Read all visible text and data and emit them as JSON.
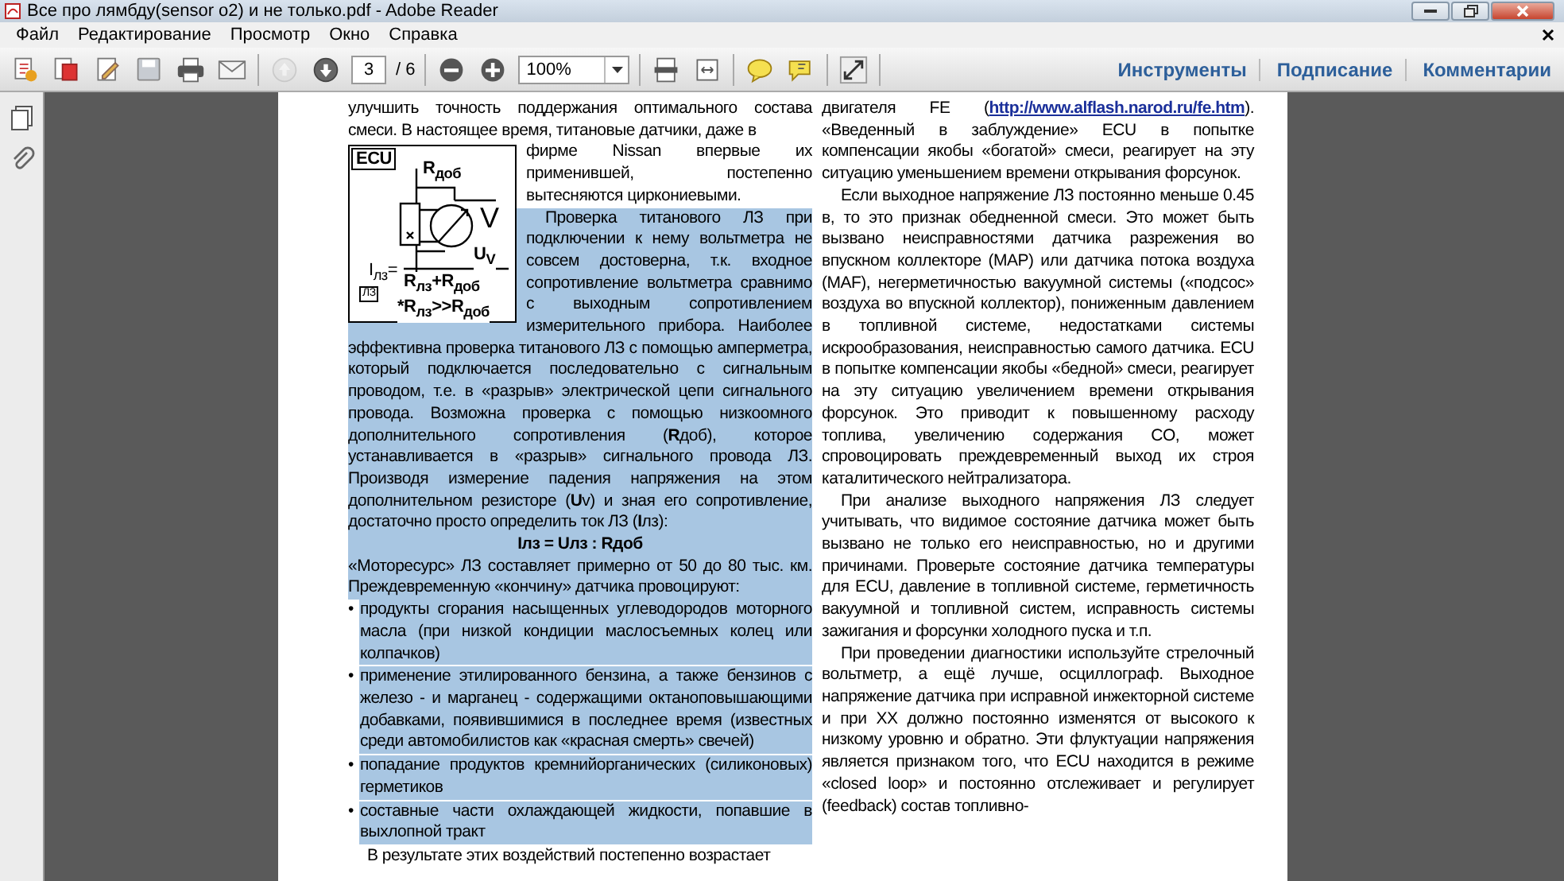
{
  "window": {
    "title": "Все про лямбду(sensor o2) и не только.pdf - Adobe Reader"
  },
  "menu": [
    "Файл",
    "Редактирование",
    "Просмотр",
    "Окно",
    "Справка"
  ],
  "toolbar": {
    "groups": [
      [
        {
          "kind": "create",
          "disabled": false
        },
        {
          "kind": "combine",
          "disabled": false
        },
        {
          "kind": "edit",
          "disabled": false
        },
        {
          "kind": "save",
          "disabled": false
        },
        {
          "kind": "print",
          "disabled": false
        },
        {
          "kind": "mail",
          "disabled": false
        }
      ],
      [
        {
          "kind": "prev",
          "disabled": true
        },
        {
          "kind": "next",
          "disabled": false
        },
        {
          "kind": "page",
          "value": "3",
          "total": "/ 6",
          "disabled": false
        }
      ],
      [
        {
          "kind": "zoom-out",
          "disabled": false
        },
        {
          "kind": "zoom-in",
          "disabled": false
        },
        {
          "kind": "zoom",
          "value": "100%",
          "disabled": false
        }
      ],
      [
        {
          "kind": "fit-page",
          "disabled": false
        },
        {
          "kind": "fit-width",
          "disabled": false
        }
      ],
      [
        {
          "kind": "comment",
          "disabled": false
        },
        {
          "kind": "highlight",
          "disabled": false
        }
      ],
      [
        {
          "kind": "fullscreen",
          "disabled": false
        }
      ]
    ],
    "links": [
      "Инструменты",
      "Подписание",
      "Комментарии"
    ]
  },
  "document": {
    "left_column": [
      {
        "kind": "paragraph",
        "indent": false,
        "selected": false,
        "text": "улучшить точность поддержания оптимального состава смеси. В настоящее время, титановые датчики, даже в"
      },
      {
        "kind": "figure",
        "labels": {
          "ecu": "ECU",
          "resistor": "R$_{доб}$",
          "meter": "V",
          "numerator": "U$_{V}$",
          "lhs": "I$_{лз}$=",
          "denominator": "R$_{лз}$+R$_{доб}$",
          "condition": "*R$_{лз}$>>R$_{доб}$",
          "sensor": "ЛЗ"
        }
      },
      {
        "kind": "paragraph",
        "indent": false,
        "selected": false,
        "text": "фирме Nissan впервые их применившей, постепенно вытесняются циркониевыми."
      },
      {
        "kind": "paragraph",
        "indent": true,
        "selected": true,
        "text": "Проверка титанового ЛЗ при подключении к нему вольтметра не совсем достоверна, т.к. входное сопротивление вольтметра сравнимо с выходным сопротивлением измерительного прибора. Наиболее эффективна проверка титанового ЛЗ с помощью амперметра, который подключается последовательно с сигнальным проводом, т.е. в «разрыв» электрической цепи сигнального провода. Возможна проверка с помощью низкоомного дополнительного сопротивления (**R**доб), которое устанавливается в «разрыв» сигнального провода ЛЗ. Производя измерение падения напряжения на этом дополнительном резисторе (**U**v) и зная его сопротивление, достаточно просто определить ток ЛЗ (**I**лз):"
      },
      {
        "kind": "formula",
        "selected": true,
        "text": "Iлз = Uлз : Rдоб"
      },
      {
        "kind": "paragraph",
        "indent": false,
        "selected": true,
        "text": "«Моторесурс» ЛЗ составляет примерно от 50 до 80 тыс. км. Преждевременную «кончину» датчика провоцируют:"
      },
      {
        "kind": "bullet",
        "marker": "•",
        "selected": true,
        "text": "продукты сгорания насыщенных углеводородов моторного масла (при низкой кондиции маслосъемных колец или колпачков)"
      },
      {
        "kind": "bullet",
        "marker": "•",
        "selected": true,
        "text": "применение этилированного бензина, а также бензинов с железо - и марганец - содержащими октаноповышающими добавками, появившимися в последнее время (известных среди автомобилистов как «красная смерть» свечей)"
      },
      {
        "kind": "bullet",
        "marker": "•",
        "selected": true,
        "text": "попадание продуктов кремнийорганических (силиконовых) герметиков"
      },
      {
        "kind": "bullet",
        "marker": "•",
        "selected": true,
        "text": "составные части охлаждающей жидкости, попавшие в выхлопной тракт"
      },
      {
        "kind": "paragraph",
        "indent": true,
        "selected": false,
        "text": "В результате этих воздействий постепенно возрастает"
      }
    ],
    "right_column": [
      {
        "kind": "link-paragraph",
        "indent": false,
        "selected": false,
        "before": "двигателя FE (",
        "link": "http://www.alflash.narod.ru/fe.htm",
        "after": "). «Введенный в заблуждение» ECU в попытке компенсации якобы «богатой» смеси, реагирует на эту ситуацию уменьшением времени открывания форсунок."
      },
      {
        "kind": "paragraph",
        "indent": true,
        "selected": false,
        "text": "Если выходное напряжение ЛЗ постоянно меньше 0.45 в, то это  признак обедненной смеси. Это может быть вызвано неисправностями датчика разрежения во впускном коллекторе (MAP) или датчика потока воздуха (MAF), негерметичностью вакуумной системы («подсос» воздуха во впускной коллектор), пониженным давлением в топливной системе, недостатками системы искрообразования, неисправностью самого датчика. ECU в попытке компенсации якобы «бедной» смеси, реагирует на эту ситуацию увеличением времени открывания форсунок. Это приводит к повышенному расходу топлива, увеличению содержания CO, может спровоцировать преждевременный выход их строя каталитического нейтрализатора."
      },
      {
        "kind": "paragraph",
        "indent": true,
        "selected": false,
        "text": "При анализе выходного напряжения ЛЗ следует учитывать, что видимое состояние датчика может быть вызвано не только его неисправностью, но и другими причинами. Проверьте состояние датчика температуры для ECU, давление в топливной системе, герметичность вакуумной и топливной систем, исправность системы зажигания и форсунки холодного пуска и т.п."
      },
      {
        "kind": "paragraph",
        "indent": true,
        "selected": false,
        "text": "При проведении диагностики используйте стрелочный вольтметр, а ещё лучше, осциллограф. Выходное напряжение датчика при исправной инжекторной системе и при XX должно постоянно изменятся от высокого к низкому уровню и обратно. Эти флуктуации напряжения является признаком того, что ECU находится в режиме «closed loop» и постоянно отслеживает и регулирует (feedback) состав топливно-"
      }
    ]
  }
}
